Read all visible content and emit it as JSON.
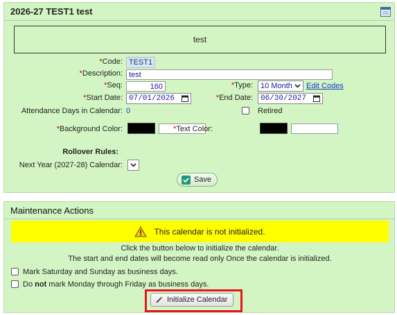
{
  "calendar_panel": {
    "title": "2026-27 TEST1 test",
    "display_name": "test",
    "code_label": "Code:",
    "code_value": "TEST1",
    "description_label": "Description:",
    "description_value": "test",
    "seq_label": "Seq:",
    "seq_value": "160",
    "type_label": "Type:",
    "type_value": "10 Month",
    "edit_codes_link": "Edit Codes",
    "start_date_label": "Start Date:",
    "start_date_value": "07/01/2026",
    "end_date_label": "End Date:",
    "end_date_value": "06/30/2027",
    "attendance_days_label": "Attendance Days in Calendar:",
    "attendance_days_value": "0",
    "retired_label": "Retired",
    "background_color_label": "Background Color:",
    "text_color_label": "Text Color:",
    "rollover_heading": "Rollover Rules:",
    "next_year_label": "Next Year (2027-28) Calendar:",
    "save_button": "Save",
    "required_marker": "*"
  },
  "maintenance_panel": {
    "title": "Maintenance Actions",
    "warning_text": "This calendar is not initialized.",
    "info_line_1": "Click the button below to initialize the calendar.",
    "info_line_2": "The start and end dates will become read only Once the calendar is initialized.",
    "checkbox_saturday_label": "Mark Saturday and Sunday as business days.",
    "checkbox_weekday_prefix": "Do ",
    "checkbox_weekday_bold": "not",
    "checkbox_weekday_suffix": " mark Monday through Friday as business days.",
    "initialize_button": "Initialize Calendar"
  },
  "colors": {
    "panel_background": "#d2f5c3",
    "warning_background": "#ffff00",
    "required_marker": "#d40000",
    "link": "#1a3ac8",
    "highlight_outline": "#e8141e"
  },
  "icons": {
    "header_icon": "calendar-icon",
    "date_picker": "calendar-icon",
    "warning": "warning-triangle-icon",
    "save": "check-icon",
    "initialize": "wand-icon",
    "dropdown": "chevron-down-icon"
  }
}
